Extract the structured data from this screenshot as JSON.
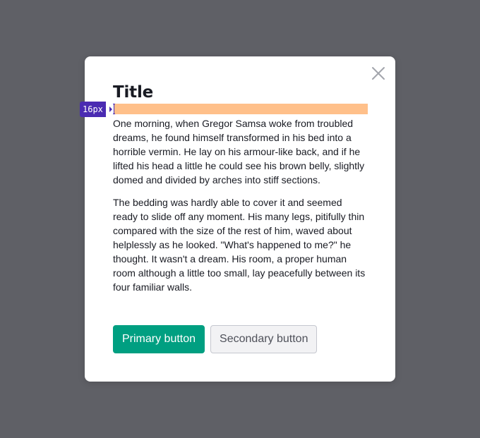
{
  "modal": {
    "title": "Title",
    "close_icon": "close-icon",
    "spacing_indicator": {
      "label": "16px",
      "highlight_color": "#ffc08a",
      "badge_color": "#4a2bb2"
    },
    "paragraphs": [
      "One morning, when Gregor Samsa woke from troubled dreams, he found himself transformed in his bed into a horrible vermin. He lay on his armour-like back, and if he lifted his head a little he could see his brown belly, slightly domed and divided by arches into stiff sections.",
      "The bedding was hardly able to cover it and seemed ready to slide off any moment. His many legs, pitifully thin compared with the size of the rest of him, waved about helplessly as he looked. \"What's happened to me?\" he thought. It wasn't a dream. His room, a proper human room although a little too small, lay peacefully between its four familiar walls."
    ],
    "buttons": {
      "primary_label": "Primary button",
      "secondary_label": "Secondary button"
    }
  },
  "colors": {
    "overlay": "#5f6066",
    "primary": "#009f81",
    "secondary_bg": "#f2f2f4",
    "secondary_border": "#c5c7cf",
    "text": "#191b23"
  }
}
